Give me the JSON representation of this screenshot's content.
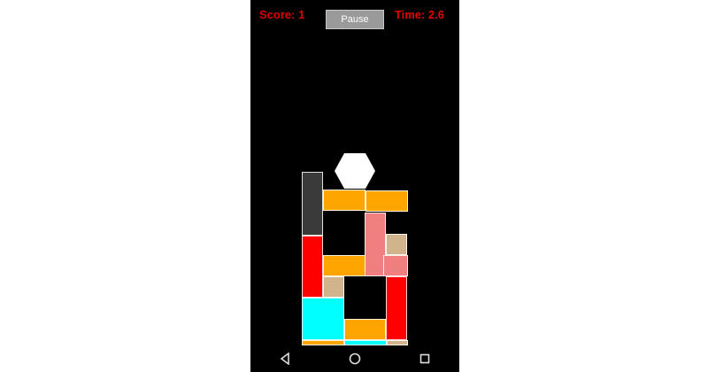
{
  "hud": {
    "score_text": "Score: 1",
    "time_text": "Time: 2.6",
    "pause_label": "Pause"
  },
  "colors": {
    "background": "#000000",
    "hud_text": "#e00000",
    "orange": "#ffa500",
    "red": "#ff0000",
    "dark_gray": "#3a3a3a",
    "salmon": "#f08080",
    "tan": "#d2b48c",
    "cyan": "#00ffff",
    "hexagon": "#ffffff"
  },
  "game": {
    "falling_piece": "hexagon-piece",
    "blocks": [
      {
        "name": "dark-gray-block",
        "color": "dark_gray"
      },
      {
        "name": "orange-block",
        "color": "orange"
      },
      {
        "name": "orange-block",
        "color": "orange"
      },
      {
        "name": "red-block",
        "color": "red"
      },
      {
        "name": "salmon-l-block",
        "color": "salmon"
      },
      {
        "name": "tan-block",
        "color": "tan"
      },
      {
        "name": "orange-block",
        "color": "orange"
      },
      {
        "name": "tan-block",
        "color": "tan"
      },
      {
        "name": "red-block",
        "color": "red"
      },
      {
        "name": "cyan-block",
        "color": "cyan"
      },
      {
        "name": "orange-block",
        "color": "orange"
      },
      {
        "name": "orange-block",
        "color": "orange"
      },
      {
        "name": "cyan-block",
        "color": "cyan"
      },
      {
        "name": "tan-block",
        "color": "tan"
      }
    ]
  },
  "navbar": {
    "icons": [
      "back-icon",
      "home-icon",
      "recents-icon"
    ]
  }
}
